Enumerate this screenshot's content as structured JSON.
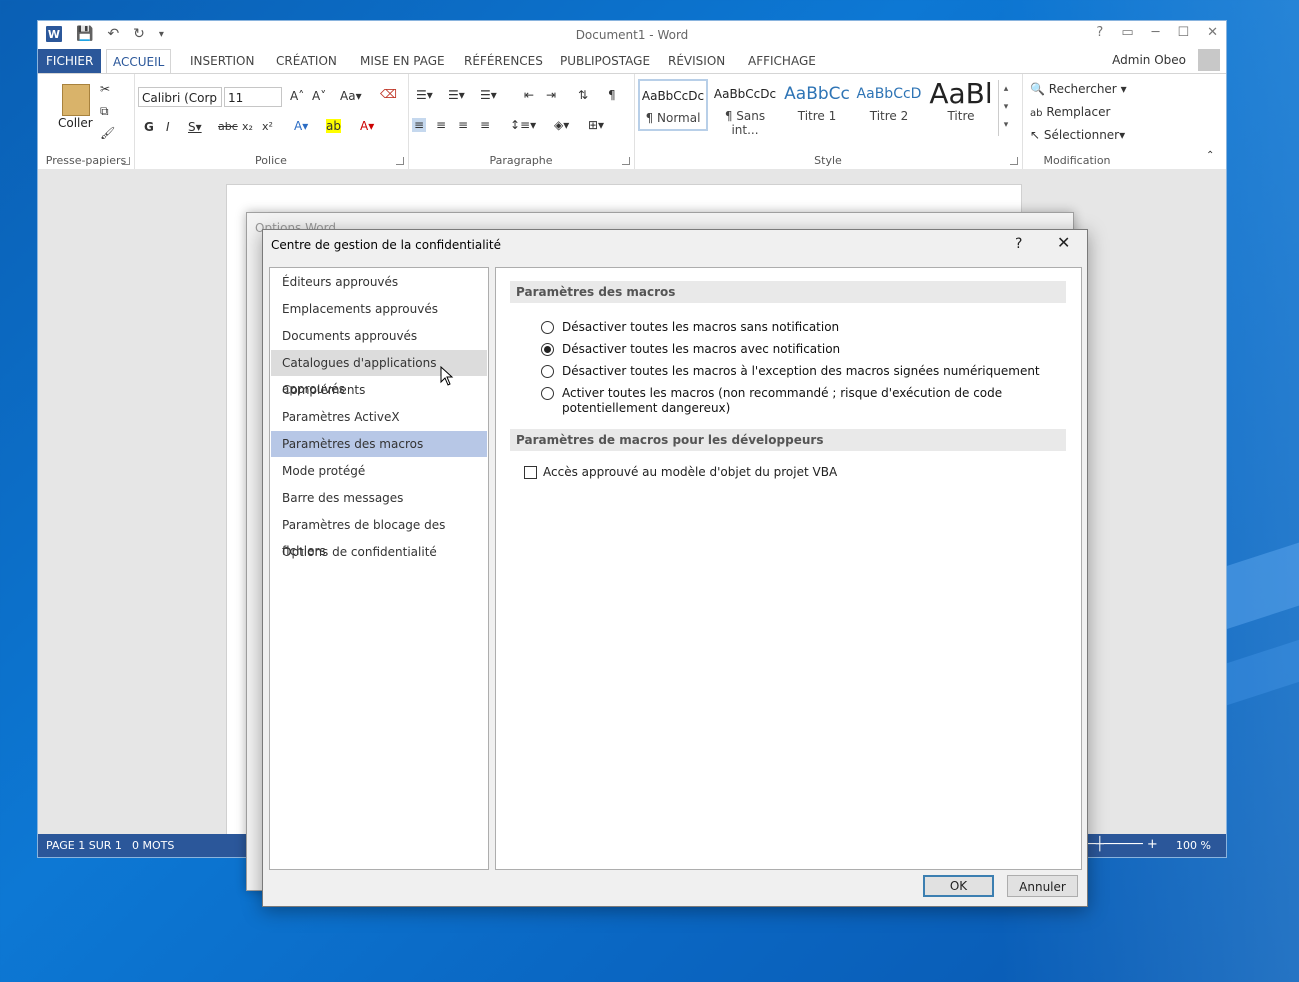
{
  "word": {
    "title": "Document1 - Word",
    "user": "Admin Obeo",
    "tabs": {
      "file": "FICHIER",
      "home": "ACCUEIL",
      "insert": "INSERTION",
      "design": "CRÉATION",
      "layout": "MISE EN PAGE",
      "references": "RÉFÉRENCES",
      "mailings": "PUBLIPOSTAGE",
      "review": "RÉVISION",
      "view": "AFFICHAGE"
    },
    "ribbon": {
      "clipboard_label": "Presse-papiers",
      "paste_label": "Coller",
      "font_label": "Police",
      "font_name": "Calibri (Corp",
      "font_size": "11",
      "paragraph_label": "Paragraphe",
      "style_label": "Style",
      "styles": [
        {
          "sample": "AaBbCcDc",
          "name": "¶ Normal"
        },
        {
          "sample": "AaBbCcDc",
          "name": "¶ Sans int..."
        },
        {
          "sample": "AaBbCc",
          "name": "Titre 1"
        },
        {
          "sample": "AaBbCcD",
          "name": "Titre 2"
        },
        {
          "sample": "AaBl",
          "name": "Titre"
        }
      ],
      "editing_label": "Modification",
      "find": "Rechercher",
      "replace": "Remplacer",
      "select": "Sélectionner"
    },
    "status": {
      "page": "PAGE 1 SUR 1",
      "words": "0 MOTS",
      "zoom": "100 %"
    }
  },
  "options_dialog": {
    "title": "Options Word"
  },
  "trust_center": {
    "title": "Centre de gestion de la confidentialité",
    "help": "?",
    "nav": [
      "Éditeurs approuvés",
      "Emplacements approuvés",
      "Documents approuvés",
      "Catalogues d'applications approuvés",
      "Compléments",
      "Paramètres ActiveX",
      "Paramètres des macros",
      "Mode protégé",
      "Barre des messages",
      "Paramètres de blocage des fichiers",
      "Options de confidentialité"
    ],
    "macro_section": "Paramètres des macros",
    "macro_options": [
      {
        "label": "Désactiver toutes les macros sans notification",
        "selected": false
      },
      {
        "label": "Désactiver toutes les macros avec notification",
        "selected": true
      },
      {
        "label": "Désactiver toutes les macros à l'exception des macros signées numériquement",
        "selected": false
      },
      {
        "label": "Activer toutes les macros (non recommandé ; risque d'exécution de code potentiellement dangereux)",
        "selected": false
      }
    ],
    "dev_section": "Paramètres de macros pour les développeurs",
    "vba_checkbox": "Accès approuvé au modèle d'objet du projet VBA",
    "ok": "OK",
    "cancel": "Annuler"
  }
}
